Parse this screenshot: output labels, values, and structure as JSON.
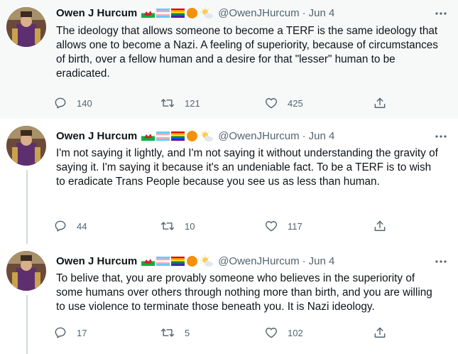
{
  "tweets": [
    {
      "author_name": "Owen J Hurcum",
      "handle": "@OwenJHurcum",
      "date": "Jun 4",
      "separator": "·",
      "text": "The ideology that allows someone to become a TERF is the same ideology that allows one to become a Nazi. A feeling of superiority, because of circumstances of birth, over a fellow human and a desire for that \"lesser\" human to be eradicated.",
      "replies": "140",
      "retweets": "121",
      "likes": "425"
    },
    {
      "author_name": "Owen J Hurcum",
      "handle": "@OwenJHurcum",
      "date": "Jun 4",
      "separator": "·",
      "text": "I'm not saying it lightly, and I'm not saying it without understanding the gravity of saying it. I'm saying it because it's an undeniable fact. To be a TERF is to wish to eradicate Trans People because you see us as less than human.",
      "replies": "44",
      "retweets": "10",
      "likes": "117"
    },
    {
      "author_name": "Owen J Hurcum",
      "handle": "@OwenJHurcum",
      "date": "Jun 4",
      "separator": "·",
      "text": "To belive that, you are provably someone who believes in the superiority of some humans over others through nothing more than birth, and you are willing to use violence to terminate those beneath you. It is Nazi ideology.",
      "replies": "17",
      "retweets": "5",
      "likes": "102"
    }
  ],
  "name_emojis": [
    "welsh-flag",
    "trans-flag",
    "rainbow-flag",
    "orange-circle",
    "sun-behind-cloud"
  ],
  "colors": {
    "text": "#0f1419",
    "secondary": "#536471",
    "highlight_bg": "#f7f9f9",
    "thread_line": "#cfd9de"
  }
}
